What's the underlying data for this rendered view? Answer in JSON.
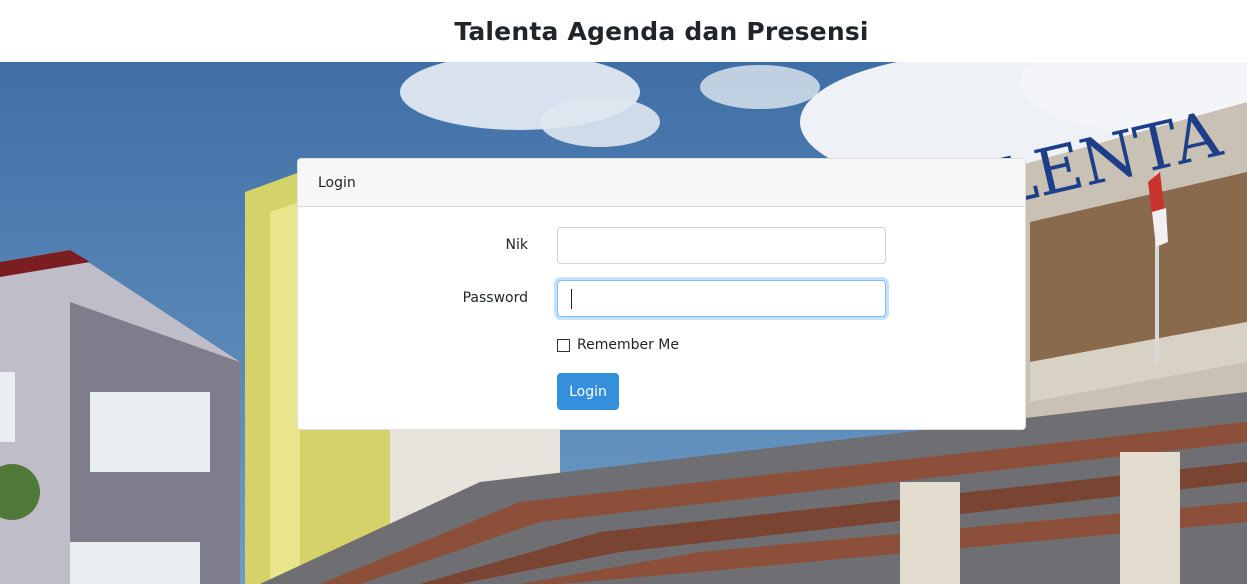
{
  "header": {
    "title": "Talenta Agenda dan Presensi"
  },
  "background": {
    "building_sign": "LENTA"
  },
  "login_card": {
    "header_label": "Login",
    "nik_label": "Nik",
    "nik_value": "",
    "password_label": "Password",
    "password_value": "",
    "remember_label": "Remember Me",
    "remember_checked": false,
    "submit_label": "Login"
  },
  "colors": {
    "primary_button": "#3490dc",
    "card_header_bg": "#f7f7f7",
    "focus_border": "#80bdff"
  }
}
